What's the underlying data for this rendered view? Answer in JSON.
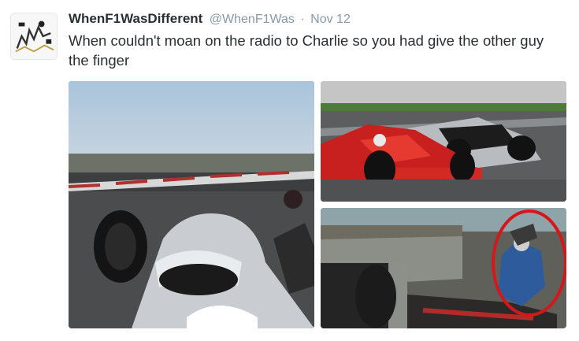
{
  "tweet": {
    "display_name": "WhenF1WasDifferent",
    "handle": "@WhenF1Was",
    "separator": "·",
    "date": "Nov 12",
    "text": "When couldn't moan on the radio to Charlie so you had give the other guy the finger"
  },
  "media": [
    {
      "icon": "onboard-camera-photo"
    },
    {
      "icon": "ferrari-mclaren-racing-photo"
    },
    {
      "icon": "crash-photo-with-red-circle"
    }
  ]
}
